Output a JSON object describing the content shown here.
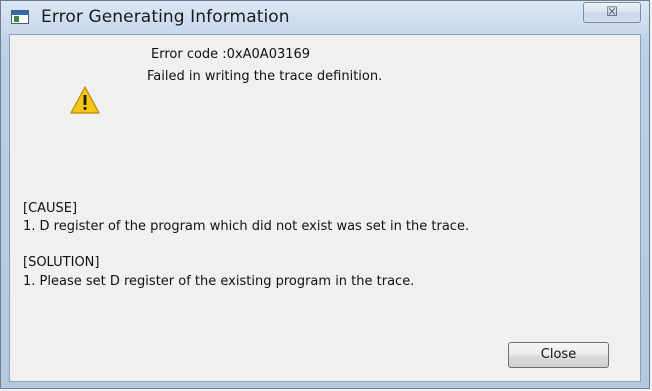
{
  "window": {
    "title": "Error Generating Information",
    "close_glyph": "☒"
  },
  "message": {
    "icon": "warning-icon",
    "error_code": "Error code :0xA0A03169",
    "summary": "Failed in writing the trace definition."
  },
  "cause": {
    "heading": "[CAUSE]",
    "text": "1. D register of the program which did not exist was set in the trace."
  },
  "solution": {
    "heading": "[SOLUTION]",
    "text": "1. Please set D register of the existing program in the trace."
  },
  "buttons": {
    "close_label": "Close"
  },
  "colors": {
    "title_bar": "#c6d8ec",
    "client_bg": "#f0f0f0",
    "warning_fill": "#f5c518"
  }
}
